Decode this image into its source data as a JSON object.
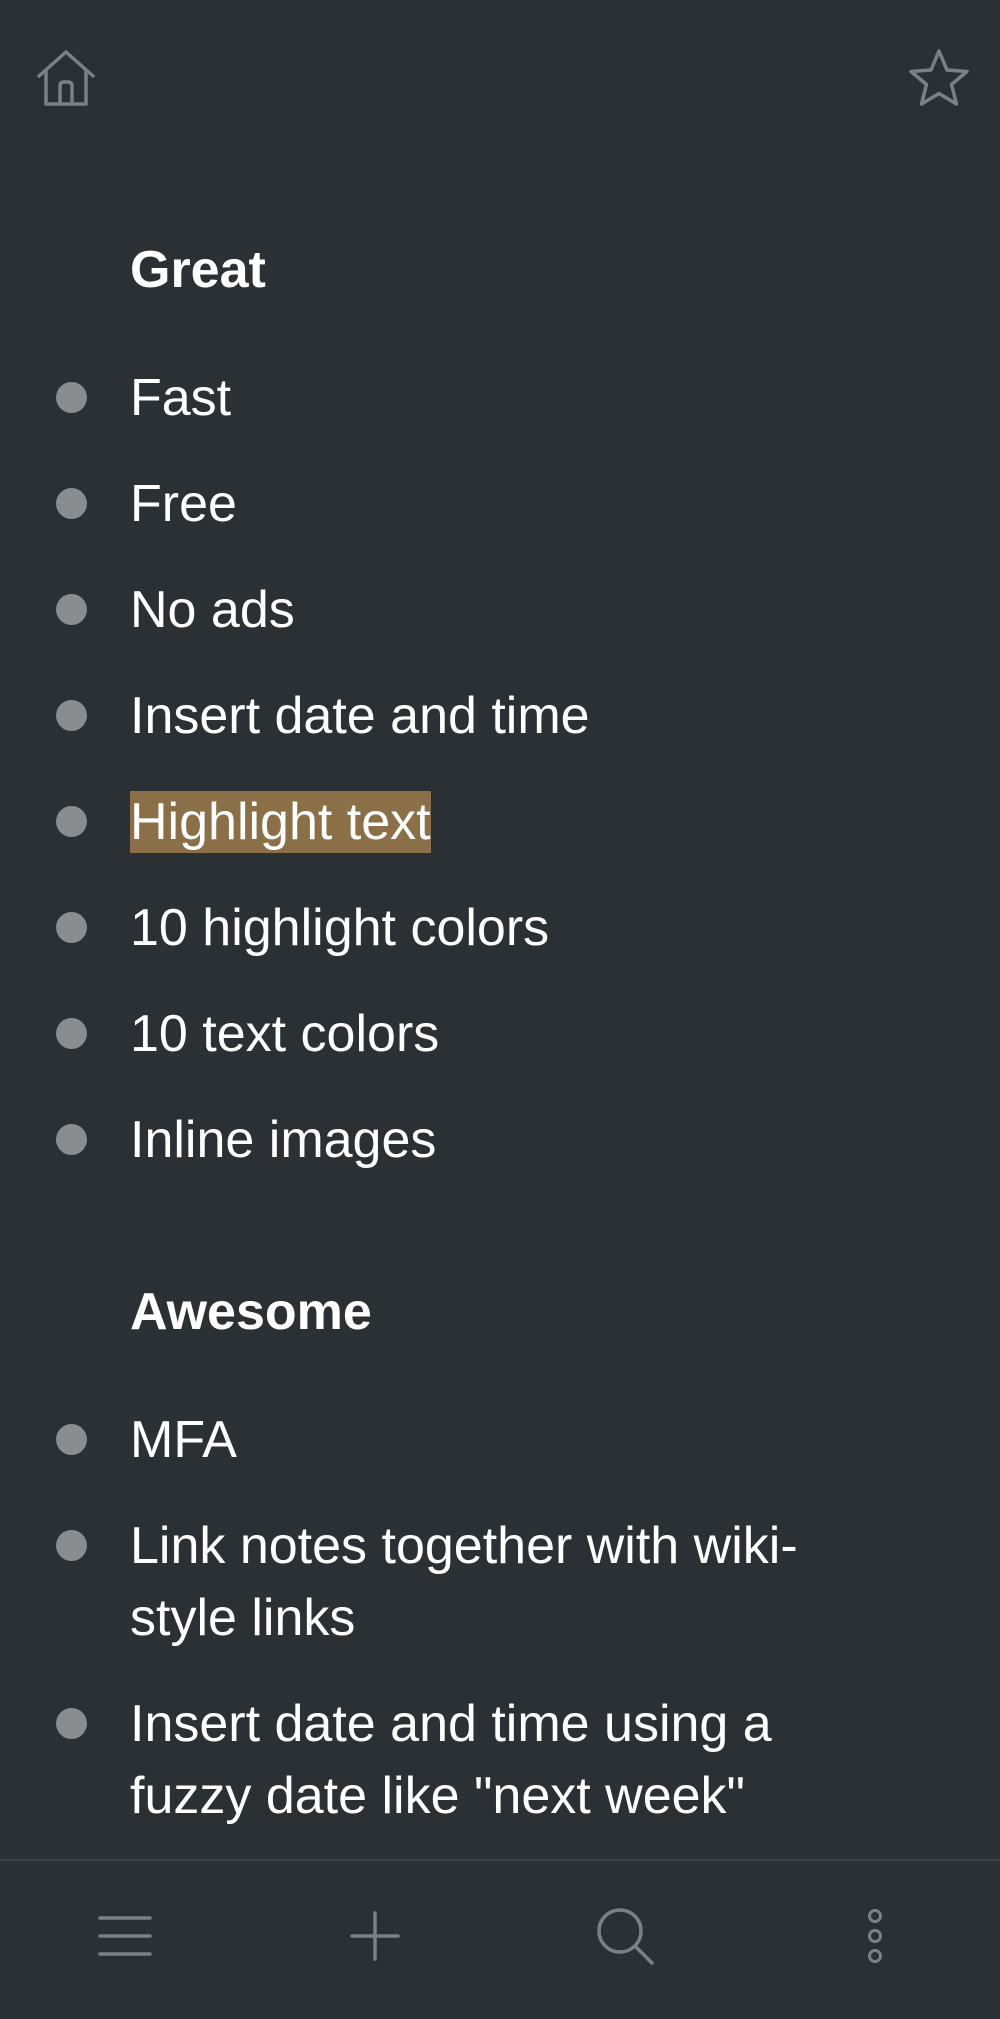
{
  "header": {
    "home_icon": "home-icon",
    "star_icon": "star-icon"
  },
  "sections": [
    {
      "heading": "Great",
      "items": [
        {
          "text": "Fast"
        },
        {
          "text": "Free"
        },
        {
          "text": "No ads"
        },
        {
          "text": "Insert date and time"
        },
        {
          "text": "Highlight text",
          "highlight": "#8b6f47"
        },
        {
          "text": "10 highlight colors"
        },
        {
          "text": "10 text colors"
        },
        {
          "text": "Inline images"
        }
      ]
    },
    {
      "heading": "Awesome",
      "items": [
        {
          "text": "MFA"
        },
        {
          "text": "Link notes together with wiki-style links"
        },
        {
          "text": "Insert date and time using a fuzzy date like \"next week\""
        }
      ]
    }
  ],
  "toolbar": {
    "menu_icon": "menu-icon",
    "add_icon": "plus-icon",
    "search_icon": "search-icon",
    "more_icon": "more-vertical-icon"
  },
  "colors": {
    "background": "#2b3035",
    "highlight": "#8b6f47",
    "bullet": "#8a8d90",
    "icon": "#7c8085"
  }
}
